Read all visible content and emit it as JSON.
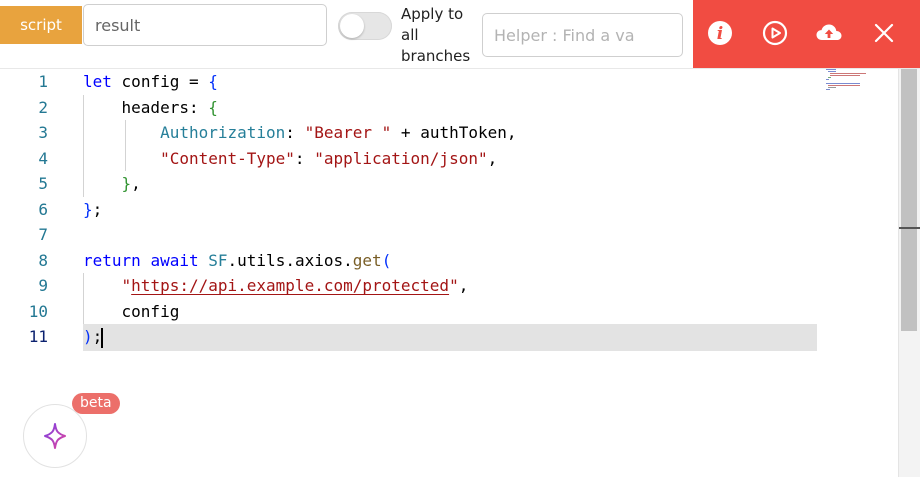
{
  "toolbar": {
    "language": "script",
    "name_value": "result",
    "apply_all_label": "Apply to all branches",
    "apply_all_checked": false,
    "helper_placeholder": "Helper : Find a va",
    "accent_color": "#f14c42",
    "actions": [
      {
        "name": "info",
        "icon": "info-icon"
      },
      {
        "name": "run",
        "icon": "play-icon"
      },
      {
        "name": "upload",
        "icon": "cloud-upload-icon"
      },
      {
        "name": "close",
        "icon": "close-icon"
      }
    ]
  },
  "editor": {
    "line_numbers": [
      "1",
      "2",
      "3",
      "4",
      "5",
      "6",
      "7",
      "8",
      "9",
      "10",
      "11"
    ],
    "active_line": 11,
    "tokens": {
      "l1": {
        "let": "let",
        "config": "config",
        "eq": "=",
        "open": "{"
      },
      "l2": {
        "headers": "headers",
        "colon": ":",
        "open": "{"
      },
      "l3": {
        "auth": "Authorization",
        "colon": ":",
        "bearer": "\"Bearer \"",
        "plus": "+",
        "token": "authToken",
        "comma": ","
      },
      "l4": {
        "ct": "\"Content-Type\"",
        "colon": ":",
        "json": "\"application/json\"",
        "comma": ","
      },
      "l5": {
        "close": "}",
        "comma": ","
      },
      "l6": {
        "close": "}",
        "semi": ";"
      },
      "l8": {
        "return": "return",
        "await": "await",
        "sf": "SF",
        "dot1": ".",
        "utils": "utils",
        "dot2": ".",
        "axios": "axios",
        "dot3": ".",
        "get": "get",
        "open": "("
      },
      "l9": {
        "q1": "\"",
        "url": "https://api.example.com/protected",
        "q2": "\"",
        "comma": ","
      },
      "l10": {
        "config": "config"
      },
      "l11": {
        "close": ")",
        "semi": ";"
      }
    }
  },
  "ai": {
    "badge": "beta",
    "icon": "sparkle-icon"
  }
}
